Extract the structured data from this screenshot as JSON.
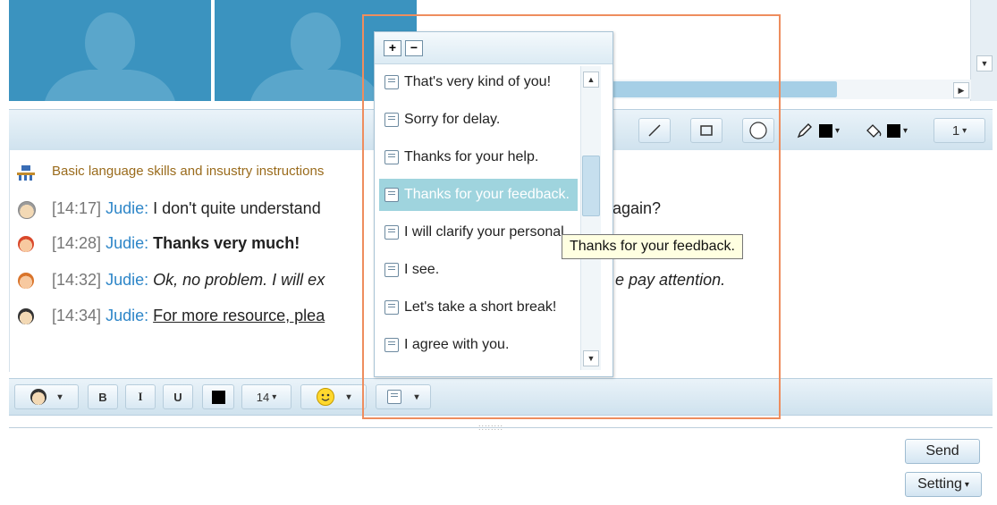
{
  "notice": "Basic language skills and insustry instructions",
  "messages": [
    {
      "time": "[14:17]",
      "name": "Judie:",
      "text_before": "I don't quite understand",
      "text_after": "again?",
      "style": "normal"
    },
    {
      "time": "[14:28]",
      "name": "Judie:",
      "text_before": "Thanks very much!",
      "text_after": "",
      "style": "bold"
    },
    {
      "time": "[14:32]",
      "name": "Judie:",
      "text_before": "Ok, no problem. I will ex",
      "text_after": "e pay attention.",
      "style": "italic"
    },
    {
      "time": "[14:34]",
      "name": "Judie:",
      "text_before": "For more resource, plea",
      "text_after": "",
      "style": "underline"
    }
  ],
  "drawing_toolbar": {
    "line_width_value": "1"
  },
  "format_toolbar": {
    "bold": "B",
    "italic": "I",
    "underline": "U",
    "font_size": "14"
  },
  "quick_phrases": {
    "add_label": "+",
    "remove_label": "−",
    "items": [
      "That's very kind of you!",
      "Sorry for delay.",
      "Thanks for your help.",
      "Thanks for your feedback.",
      "I will clarify your personal",
      "I see.",
      "Let's take a short break!",
      "I agree with you."
    ],
    "selected_index": 3
  },
  "tooltip": "Thanks for your feedback.",
  "buttons": {
    "send": "Send",
    "setting": "Setting"
  },
  "colors": {
    "accent": "#2e86c8",
    "video_bg": "#3b93bf",
    "selection": "#9fd4de",
    "highlight_border": "#ee8d5e",
    "notice_text": "#9a6b1c"
  },
  "icons": {
    "add": "plus-icon",
    "remove": "minus-icon",
    "list": "list-icon",
    "pencil": "pencil-icon",
    "bucket": "paint-bucket-icon",
    "emoji": "smiley-icon"
  }
}
